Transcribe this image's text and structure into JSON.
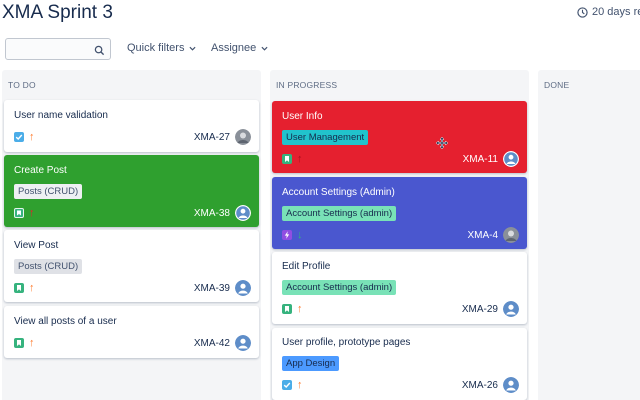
{
  "board": {
    "title": "XMA Sprint 3",
    "remaining": "20 days re"
  },
  "toolbar": {
    "search_placeholder": "",
    "search_value": "",
    "quick_filters": "Quick filters",
    "assignee": "Assignee"
  },
  "columns": {
    "todo": "TO DO",
    "in_progress": "IN PROGRESS",
    "done": "DONE"
  },
  "cards": {
    "todo": [
      {
        "title": "User name validation",
        "epic": "",
        "key": "XMA-27",
        "type": "task",
        "priority": "high",
        "avatar": "photo",
        "bg": "#ffffff"
      },
      {
        "title": "Create Post",
        "epic": "Posts (CRUD)",
        "key": "XMA-38",
        "type": "story",
        "priority": "high",
        "avatar": "default",
        "bg": "#2fa02f"
      },
      {
        "title": "View Post",
        "epic": "Posts (CRUD)",
        "key": "XMA-39",
        "type": "story",
        "priority": "high",
        "avatar": "default",
        "bg": "#ffffff"
      },
      {
        "title": "View all posts of a user",
        "epic": "",
        "key": "XMA-42",
        "type": "story",
        "priority": "high",
        "avatar": "default",
        "bg": "#ffffff"
      }
    ],
    "in_progress": [
      {
        "title": "User Info",
        "epic": "User Management",
        "key": "XMA-11",
        "type": "story",
        "priority": "high",
        "avatar": "default",
        "bg": "#e5202f"
      },
      {
        "title": "Account Settings (Admin)",
        "epic": "Account Settings (admin)",
        "key": "XMA-4",
        "type": "epic",
        "priority": "low",
        "avatar": "photo",
        "bg": "#4a57cf"
      },
      {
        "title": "Edit Profile",
        "epic": "Account Settings (admin)",
        "key": "XMA-29",
        "type": "story",
        "priority": "high",
        "avatar": "default",
        "bg": "#ffffff"
      },
      {
        "title": "User profile, prototype pages",
        "epic": "App Design",
        "key": "XMA-26",
        "type": "task",
        "priority": "high",
        "avatar": "default",
        "bg": "#ffffff"
      }
    ]
  },
  "colors": {
    "epic_posts_bg": "#dfe1e6",
    "epic_posts_text": "#42526e",
    "epic_user_mgmt_bg": "#21c3cc",
    "epic_account_bg": "#79e2b7",
    "epic_app_design_bg": "#4c9aff",
    "story_green": "#36b37e",
    "task_blue": "#4bade8",
    "epic_purple": "#904ee2",
    "priority_orange": "#ff7a2b",
    "priority_green": "#36b37e"
  },
  "icons": {
    "clock": "clock-icon",
    "search": "search-icon",
    "chevron": "chevron-down-icon",
    "move": "move-cursor-icon"
  }
}
